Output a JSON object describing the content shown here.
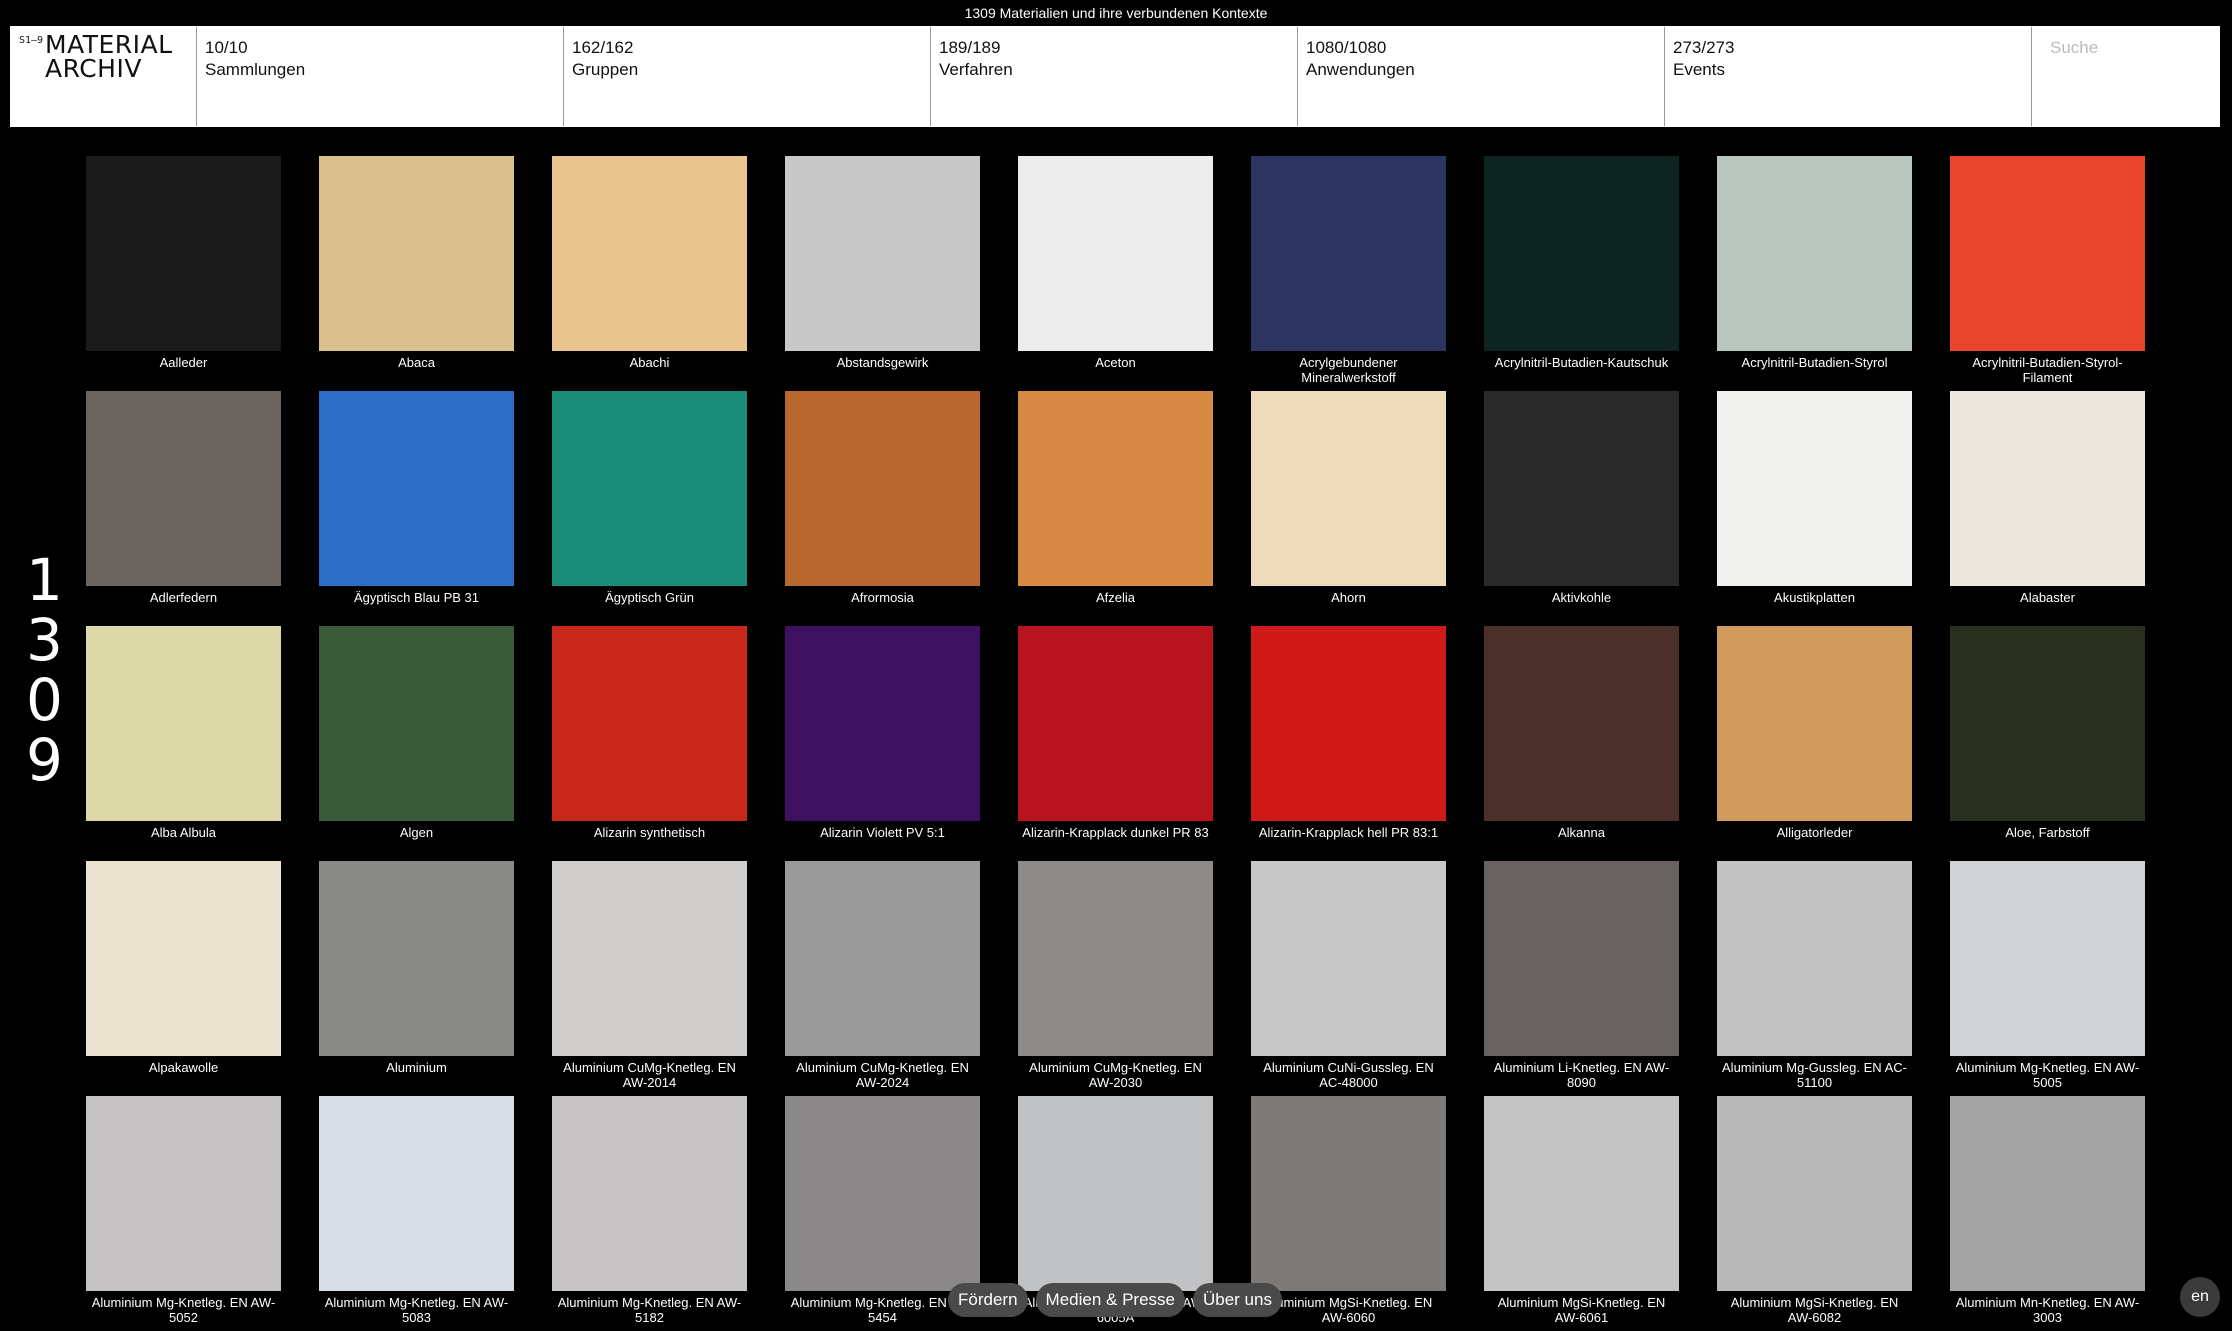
{
  "top_caption": "1309 Materialien und ihre verbundenen Kontexte",
  "logo": {
    "sup": "S1–9",
    "line1": "MATERIAL",
    "line2": "ARCHIV"
  },
  "nav": [
    {
      "count": "10/10",
      "label": "Sammlungen"
    },
    {
      "count": "162/162",
      "label": "Gruppen"
    },
    {
      "count": "189/189",
      "label": "Verfahren"
    },
    {
      "count": "1080/1080",
      "label": "Anwendungen"
    },
    {
      "count": "273/273",
      "label": "Events"
    }
  ],
  "search": {
    "placeholder": "Suche"
  },
  "total": {
    "d1": "1",
    "d2": "3",
    "d3": "0",
    "d4": "9"
  },
  "materials": [
    {
      "name": "Aalleder",
      "color": "#1a1a1a"
    },
    {
      "name": "Abaca",
      "color": "#d9c08c"
    },
    {
      "name": "Abachi",
      "color": "#e8c48e"
    },
    {
      "name": "Abstandsgewirk",
      "color": "#c8c8c8"
    },
    {
      "name": "Aceton",
      "color": "#ececec"
    },
    {
      "name": "Acrylgebundener Mineralwerkstoff",
      "color": "#2c3560"
    },
    {
      "name": "Acrylnitril-Butadien-Kautschuk",
      "color": "#0e2420"
    },
    {
      "name": "Acrylnitril-Butadien-Styrol",
      "color": "#b9c6be"
    },
    {
      "name": "Acrylnitril-Butadien-Styrol-Filament",
      "color": "#e8452c"
    },
    {
      "name": "Adlerfedern",
      "color": "#6a6560"
    },
    {
      "name": "Ägyptisch Blau PB 31",
      "color": "#2a6cc6"
    },
    {
      "name": "Ägyptisch Grün",
      "color": "#1a8c78"
    },
    {
      "name": "Afrormosia",
      "color": "#b8682e"
    },
    {
      "name": "Afzelia",
      "color": "#d88a44"
    },
    {
      "name": "Ahorn",
      "color": "#ecdcbc"
    },
    {
      "name": "Aktivkohle",
      "color": "#2a2a2a"
    },
    {
      "name": "Akustikplatten",
      "color": "#f0f0ee"
    },
    {
      "name": "Alabaster",
      "color": "#ece8e0"
    },
    {
      "name": "Alba Albula",
      "color": "#dcd8a8"
    },
    {
      "name": "Algen",
      "color": "#3a5a3a"
    },
    {
      "name": "Alizarin synthetisch",
      "color": "#c8281a"
    },
    {
      "name": "Alizarin Violett PV 5:1",
      "color": "#3e1060"
    },
    {
      "name": "Alizarin-Krapplack dunkel PR 83",
      "color": "#b81420"
    },
    {
      "name": "Alizarin-Krapplack hell PR 83:1",
      "color": "#d01a1a"
    },
    {
      "name": "Alkanna",
      "color": "#4a3028"
    },
    {
      "name": "Alligatorleder",
      "color": "#d09a5c"
    },
    {
      "name": "Aloe, Farbstoff",
      "color": "#2a3020"
    },
    {
      "name": "Alpakawolle",
      "color": "#eae4d0"
    },
    {
      "name": "Aluminium",
      "color": "#8a8a88"
    },
    {
      "name": "Aluminium CuMg-Knetleg. EN AW-2014",
      "color": "#cfcdcb"
    },
    {
      "name": "Aluminium CuMg-Knetleg. EN AW-2024",
      "color": "#9a9a9a"
    },
    {
      "name": "Aluminium CuMg-Knetleg. EN AW-2030",
      "color": "#8e8a88"
    },
    {
      "name": "Aluminium CuNi-Gussleg. EN AC-48000",
      "color": "#c8c8c8"
    },
    {
      "name": "Aluminium Li-Knetleg. EN AW-8090",
      "color": "#686260"
    },
    {
      "name": "Aluminium Mg-Gussleg. EN AC-51100",
      "color": "#c2c2c2"
    },
    {
      "name": "Aluminium Mg-Knetleg. EN AW-5005",
      "color": "#d0d2d4"
    },
    {
      "name": "Aluminium Mg-Knetleg. EN AW-5052",
      "color": "#c4c2c2"
    },
    {
      "name": "Aluminium Mg-Knetleg. EN AW-5083",
      "color": "#d8dce4"
    },
    {
      "name": "Aluminium Mg-Knetleg. EN AW-5182",
      "color": "#c6c4c4"
    },
    {
      "name": "Aluminium Mg-Knetleg. EN AW-5454",
      "color": "#8a8888"
    },
    {
      "name": "Aluminium Mg-Knetleg. EN AW-6005A",
      "color": "#c0c2c4"
    },
    {
      "name": "Aluminium MgSi-Knetleg. EN AW-6060",
      "color": "#7e7a78"
    },
    {
      "name": "Aluminium MgSi-Knetleg. EN AW-6061",
      "color": "#c4c4c4"
    },
    {
      "name": "Aluminium MgSi-Knetleg. EN AW-6082",
      "color": "#b8b8b8"
    },
    {
      "name": "Aluminium Mn-Knetleg. EN AW-3003",
      "color": "#a4a4a4"
    }
  ],
  "footer": {
    "foerdern": "Fördern",
    "medien": "Medien & Presse",
    "ueber": "Über uns"
  },
  "lang": "en"
}
